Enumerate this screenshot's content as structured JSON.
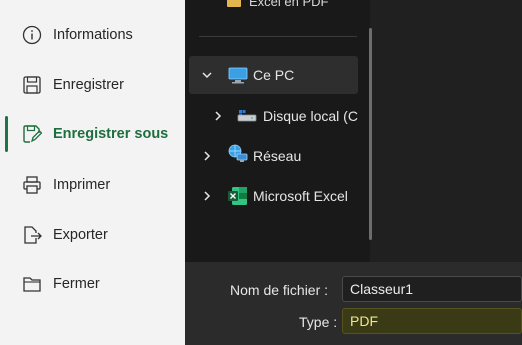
{
  "backstage": {
    "items": [
      {
        "label": "Informations",
        "icon": "info-icon"
      },
      {
        "label": "Enregistrer",
        "icon": "save-icon"
      },
      {
        "label": "Enregistrer sous",
        "icon": "save-as-icon",
        "active": true
      },
      {
        "label": "Imprimer",
        "icon": "print-icon"
      },
      {
        "label": "Exporter",
        "icon": "export-icon"
      },
      {
        "label": "Fermer",
        "icon": "folder-close-icon"
      }
    ],
    "accent_color": "#217346"
  },
  "dialog": {
    "top_item": "Excel en PDF",
    "tree": [
      {
        "label": "Ce PC",
        "icon": "pc-icon",
        "expanded": true,
        "selected": true
      },
      {
        "label": "Disque local (C",
        "icon": "drive-icon",
        "expanded": false
      },
      {
        "label": "Réseau",
        "icon": "network-icon",
        "expanded": false
      },
      {
        "label": "Microsoft Excel",
        "icon": "excel-icon",
        "expanded": false
      }
    ],
    "filename_label": "Nom de fichier :",
    "filename_value": "Classeur1",
    "type_label": "Type :",
    "type_value": "PDF"
  }
}
